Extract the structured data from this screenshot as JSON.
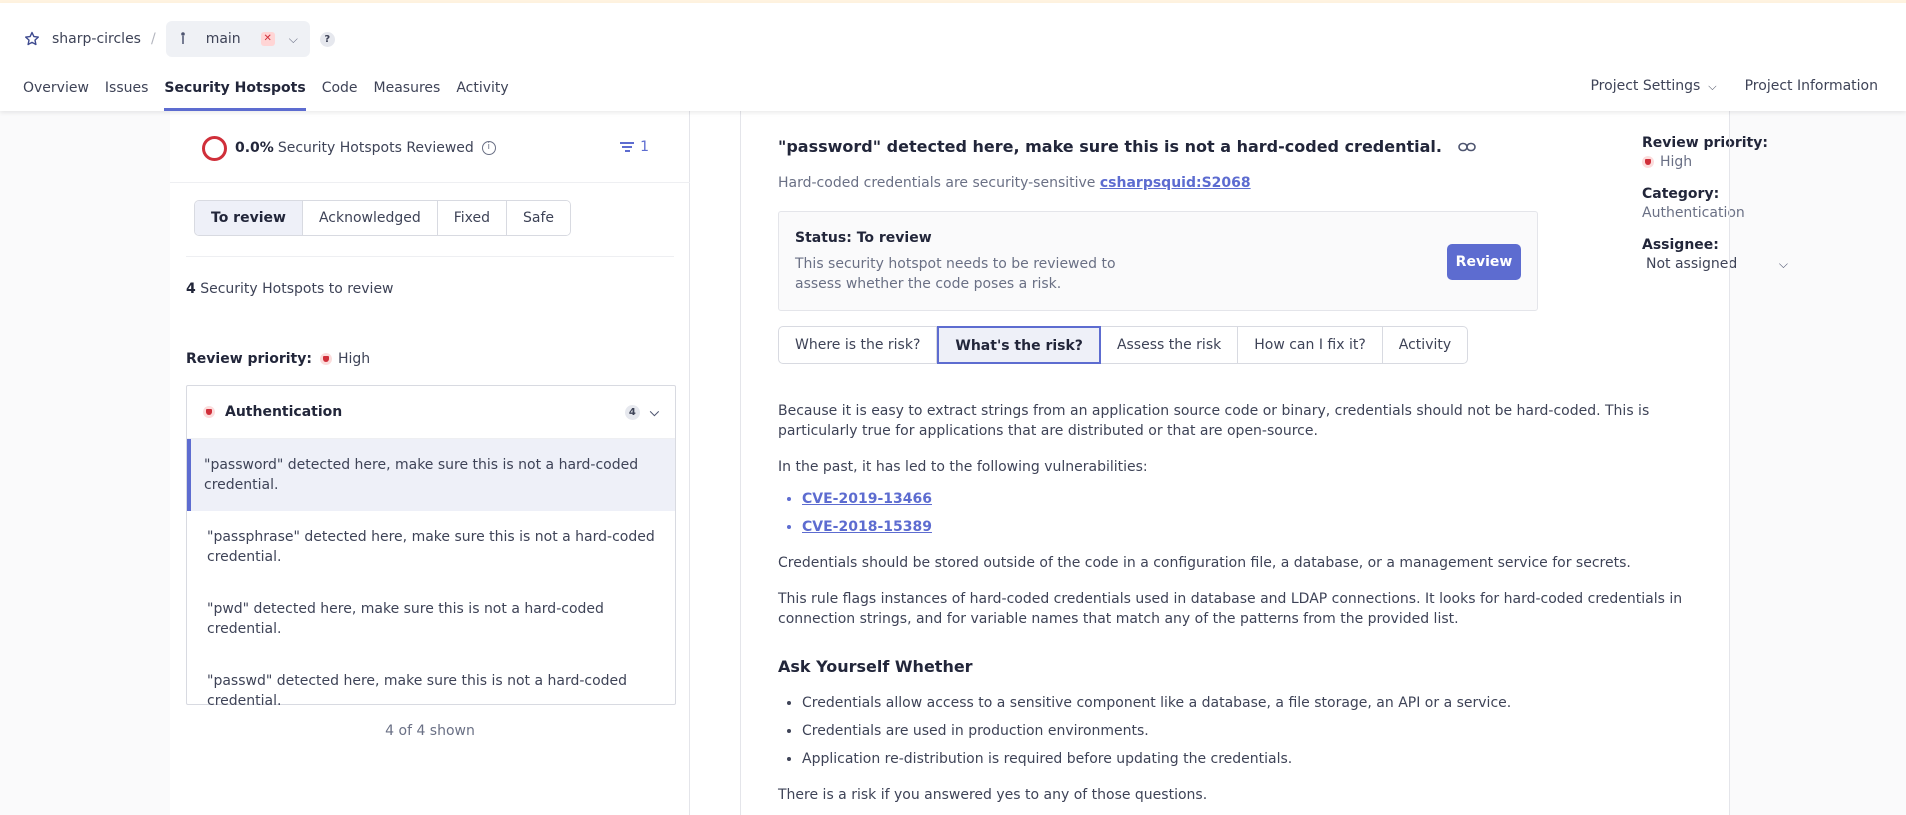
{
  "header": {
    "project_name": "sharp-circles",
    "separator": "/",
    "branch": "main",
    "branch_status": "✕",
    "help": "?",
    "nav": [
      "Overview",
      "Issues",
      "Security Hotspots",
      "Code",
      "Measures",
      "Activity"
    ],
    "active_nav": "Security Hotspots",
    "settings_label": "Project Settings",
    "info_label": "Project Information"
  },
  "left": {
    "reviewed_percent": "0.0%",
    "reviewed_label": "Security Hotspots Reviewed",
    "filter_count": "1",
    "status_tabs": [
      "To review",
      "Acknowledged",
      "Fixed",
      "Safe"
    ],
    "hotspot_count": "4",
    "hotspot_count_label": "Security Hotspots to review",
    "priority_label": "Review priority:",
    "priority_value": "High",
    "category": {
      "name": "Authentication",
      "count": "4",
      "items": [
        "\"password\" detected here, make sure this is not a hard-coded credential.",
        "\"passphrase\" detected here, make sure this is not a hard-coded credential.",
        "\"pwd\" detected here, make sure this is not a hard-coded credential.",
        "\"passwd\" detected here, make sure this is not a hard-coded credential."
      ]
    },
    "shown_label": "4 of 4 shown"
  },
  "detail": {
    "title": "\"password\" detected here, make sure this is not a hard-coded credential.",
    "subtitle_text": "Hard-coded credentials are security-sensitive",
    "rule_key": "csharpsquid:S2068",
    "status_title": "Status: To review",
    "status_desc": "This security hotspot needs to be reviewed to assess whether the code poses a risk.",
    "review_button": "Review",
    "meta": {
      "priority_label": "Review priority:",
      "priority_value": "High",
      "category_label": "Category:",
      "category_value": "Authentication",
      "assignee_label": "Assignee:",
      "assignee_value": "Not assigned"
    },
    "tabs": [
      "Where is the risk?",
      "What's the risk?",
      "Assess the risk",
      "How can I fix it?",
      "Activity"
    ],
    "active_tab": "What's the risk?",
    "article": {
      "p1": "Because it is easy to extract strings from an application source code or binary, credentials should not be hard-coded. This is particularly true for applications that are distributed or that are open-source.",
      "p2": "In the past, it has led to the following vulnerabilities:",
      "cves": [
        "CVE-2019-13466",
        "CVE-2018-15389"
      ],
      "p3": "Credentials should be stored outside of the code in a configuration file, a database, or a management service for secrets.",
      "p4": "This rule flags instances of hard-coded credentials used in database and LDAP connections. It looks for hard-coded credentials in connection strings, and for variable names that match any of the patterns from the provided list.",
      "h_ask": "Ask Yourself Whether",
      "ask_items": [
        "Credentials allow access to a sensitive component like a database, a file storage, an API or a service.",
        "Credentials are used in production environments.",
        "Application re-distribution is required before updating the credentials."
      ],
      "p5": "There is a risk if you answered yes to any of those questions."
    }
  }
}
